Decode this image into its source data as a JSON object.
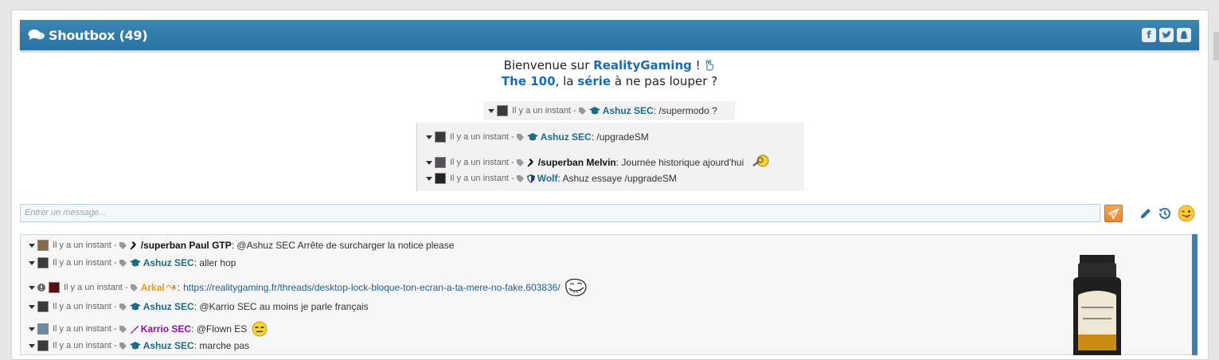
{
  "header": {
    "title": "Shoutbox (49)",
    "social_icons": [
      "facebook-icon",
      "twitter-icon",
      "snapchat-icon"
    ],
    "colors": {
      "bar": "#2d78a8",
      "text": "#ffffff"
    }
  },
  "welcome": {
    "line1_prefix": "Bienvenue sur",
    "line1_brand": "RealityGaming",
    "line1_suffix": "!",
    "line2_show": "The 100",
    "line2_mid": ", la",
    "line2_serie": "série",
    "line2_suffix": "à ne pas louper ?"
  },
  "notice": [
    {
      "time": "Il y a un instant -",
      "user": "Ashuz SEC",
      "text": ": /supermodo ?"
    },
    {
      "time": "Il y a un instant -",
      "user": "Ashuz SEC",
      "text": ": /upgradeSM"
    },
    {
      "time": "Il y a un instant -",
      "user": "/superban Melvin",
      "text": ": Journée historique ajourd'hui"
    },
    {
      "time": "Il y a un instant -",
      "user": "Wolf",
      "text": ": Ashuz essaye /upgradeSM"
    }
  ],
  "input": {
    "placeholder": "Entrer un message..."
  },
  "tools": [
    "pencil-icon",
    "history-icon",
    "tongue-emoji-icon"
  ],
  "messages": [
    {
      "time": "Il y a un instant -",
      "user": "/superban Paul GTP",
      "text": ": @Ashuz SEC Arrête de surcharger la notice please"
    },
    {
      "time": "Il y a un instant -",
      "user": "Ashuz SEC",
      "text": ": aller hop"
    },
    {
      "time": "Il y a un instant -",
      "user": "Arkal",
      "text": ":",
      "link": "https://realitygaming.fr/threads/desktop-lock-bloque-ton-ecran-a-ta-mere-no-fake.603836/"
    },
    {
      "time": "Il y a un instant -",
      "user": "Ashuz SEC",
      "text": ": @Karrio SEC au moins je parle français"
    },
    {
      "time": "Il y a un instant -",
      "user": "Karrio SEC",
      "text": ": @Flown ES"
    },
    {
      "time": "Il y a un instant -",
      "user": "Ashuz SEC",
      "text": ": marche pas"
    }
  ]
}
